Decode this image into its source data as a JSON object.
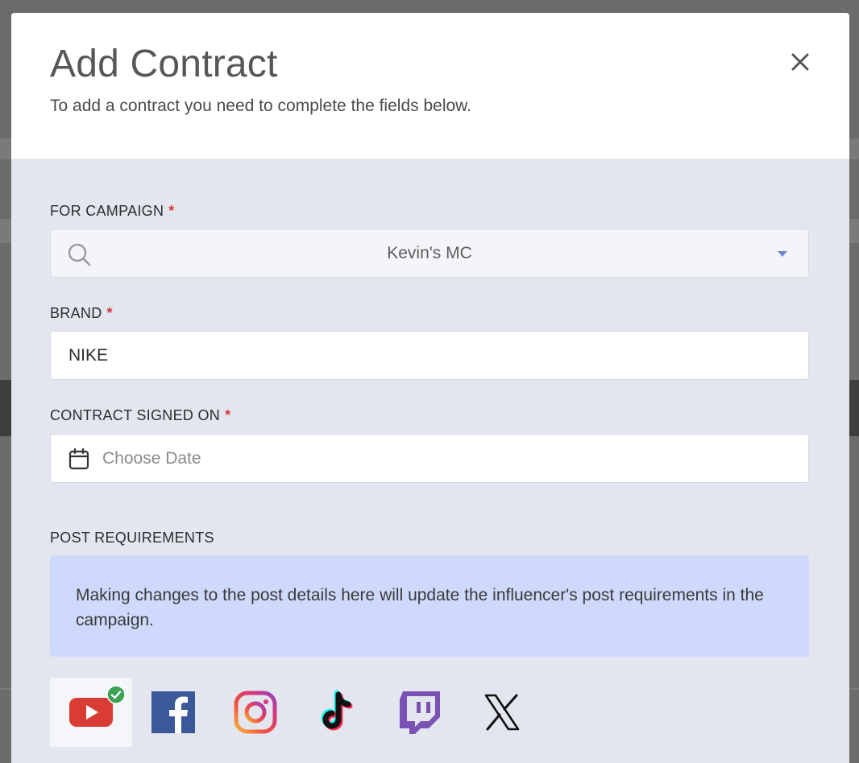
{
  "modal": {
    "title": "Add Contract",
    "subtitle": "To add a contract you need to complete the fields below."
  },
  "fields": {
    "campaign": {
      "label": "FOR CAMPAIGN",
      "required_mark": "*",
      "value": "Kevin's MC"
    },
    "brand": {
      "label": "BRAND",
      "required_mark": "*",
      "value": "NIKE"
    },
    "signed_on": {
      "label": "CONTRACT SIGNED ON",
      "required_mark": "*",
      "placeholder": "Choose Date"
    }
  },
  "post_requirements": {
    "label": "POST REQUIREMENTS",
    "notice": "Making changes to the post details here will update the influencer's post requirements in the campaign."
  },
  "platforms": [
    {
      "icon": "youtube-icon",
      "selected": true
    },
    {
      "icon": "facebook-icon",
      "selected": false
    },
    {
      "icon": "instagram-icon",
      "selected": false
    },
    {
      "icon": "tiktok-icon",
      "selected": false
    },
    {
      "icon": "twitch-icon",
      "selected": false
    },
    {
      "icon": "x-icon",
      "selected": false
    }
  ],
  "colors": {
    "required": "#d63a3a",
    "body_bg": "#e3e6ef",
    "notice_bg": "#cfd9fb",
    "youtube": "#d93c34",
    "facebook": "#3b5999",
    "twitch": "#7b52b3",
    "check": "#3aa353",
    "caret": "#6f86d6"
  }
}
